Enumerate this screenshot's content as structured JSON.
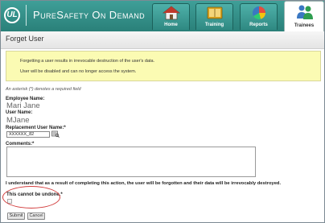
{
  "header": {
    "logo_text": "UL",
    "brand": "PureSafety On Demand",
    "tabs": [
      {
        "label": "Home",
        "icon": "house-icon"
      },
      {
        "label": "Training",
        "icon": "book-icon"
      },
      {
        "label": "Reports",
        "icon": "pie-chart-icon"
      },
      {
        "label": "Trainees",
        "icon": "people-icon",
        "active": true
      }
    ]
  },
  "page": {
    "title": "Forget User"
  },
  "warning": {
    "line1": "Forgetting a user results in irrevocable destruction of the user's data.",
    "line2": "User will be disabled and can no longer access the system."
  },
  "form": {
    "required_note": "An asterisk (*) denotes a required field",
    "employee_name_label": "Employee Name:",
    "employee_name_value": "Mari Jane",
    "user_name_label": "User Name:",
    "user_name_value": "MJane",
    "replacement_label": "Replacement User Name:",
    "replacement_required_marker": "*",
    "replacement_value": "XXXXXX_82",
    "comments_label": "Comments:",
    "comments_required_marker": "*",
    "comments_value": "",
    "acknowledge_text": "I understand that as a result of completing this action, the user will be forgotten and their data will be irrevocably destroyed.",
    "undone_label": "This cannot be undone.",
    "undone_required_marker": "*",
    "undone_checked": false
  },
  "buttons": {
    "submit": "Submit",
    "cancel": "Cancel"
  },
  "colors": {
    "header": "#2f8c85",
    "warning_bg": "#fbfbb3",
    "highlight_ellipse": "#d23c3c"
  }
}
